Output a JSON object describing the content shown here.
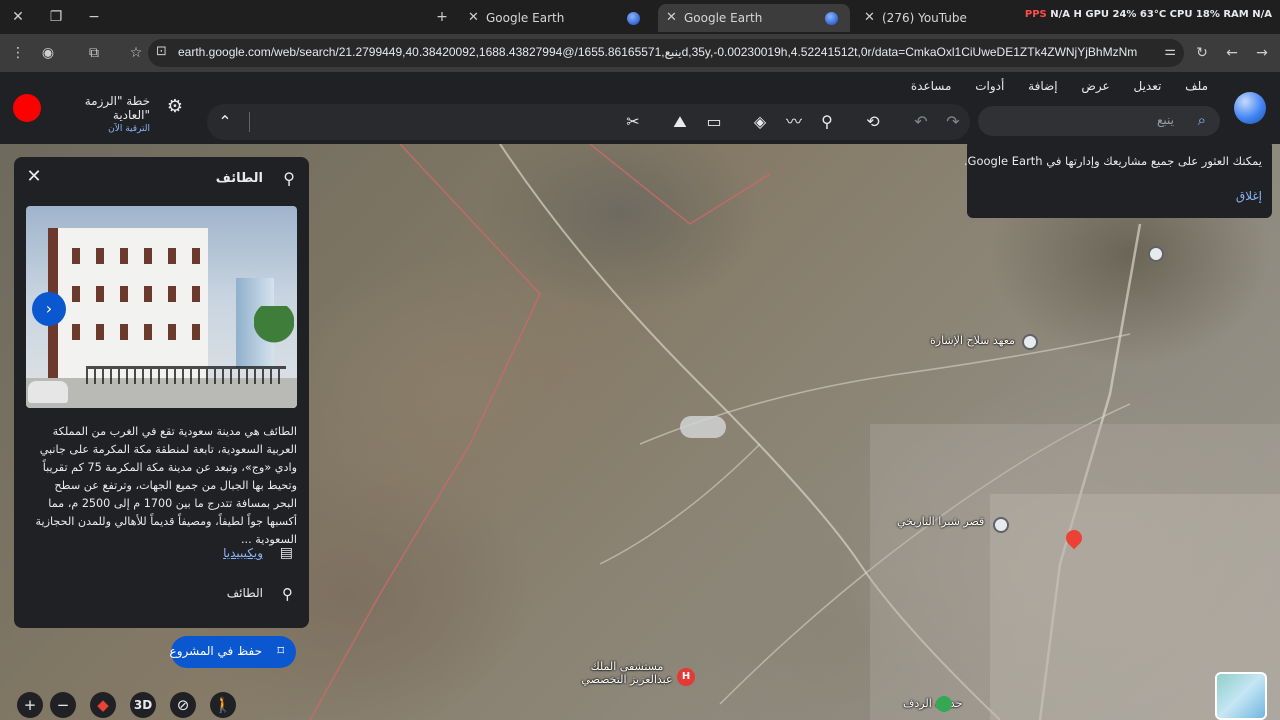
{
  "browser": {
    "tabs": [
      {
        "title": "Google Earth",
        "active": false
      },
      {
        "title": "Google Earth",
        "active": true
      },
      {
        "title": "(276) YouTube",
        "active": false
      }
    ],
    "new_tab_label": "+",
    "stats": {
      "pps": "PPS",
      "pps_val": "N/A",
      "gpu": "GPU 24% 63°C",
      "cpu": "CPU 18%",
      "ram": "RAM",
      "ram_val": "N/A",
      "h": "H"
    },
    "url": "earth.google.com/web/search/21.2799449,40.38420092,1688.43827994@/ينبع,1655.86165571d,35y,-0.00230019h,4.52241512t,0r/data=CmkaOxl1CiUweDE1ZTk4ZWNjYjBhMzNmMmY6M..."
  },
  "earth": {
    "menu": [
      "ملف",
      "تعديل",
      "عرض",
      "إضافة",
      "أدوات",
      "مساعدة"
    ],
    "plan_title": "خطة \"الرزمة العادية\"",
    "plan_upgrade": "الترقية الآن",
    "search_placeholder": "ينبع",
    "toolbar_icons": [
      "measure-icon",
      "image-icon",
      "ruler-icon",
      "layers-icon",
      "path-icon",
      "placemark-icon",
      "history-icon",
      "undo-icon",
      "redo-icon"
    ]
  },
  "panel": {
    "title": "الطائف",
    "description": "الطائف هي مدينة سعودية تقع في الغرب من المملكة العربية السعودية، تابعة لمنطقة مكة المكرمة على جانبي وادي «وج»، وتبعد عن مدينة مكة المكرمة 75 كم تقريباً وتحيط بها الجبال من جميع الجهات، وترتفع عن سطح البحر بمسافة تتدرج ما بين 1700 م إلى 2500 م، مما أكسبها جواً لطيفاً، ومصيفاً قديماً للأهالي وللمدن الحجازية السعودية ...",
    "wiki_label": "ويكيبيديا",
    "location_label": "الطائف",
    "save_label": "حفظ في المشروع"
  },
  "notice": {
    "text": "يمكنك العثور على جميع مشاريعك وإدارتها في Google Earth.",
    "close_label": "إغلاق"
  },
  "map": {
    "labels": [
      {
        "id": "label-1",
        "text": "معهد سلاح الإشارة"
      },
      {
        "id": "label-2",
        "text": "قصر شبرا التاريخي"
      },
      {
        "id": "label-3",
        "text": "مستشفى الملك عبدالعزيز التخصصي"
      },
      {
        "id": "label-4",
        "text": "حديقة الردف"
      }
    ]
  },
  "controls": {
    "zoom_in": "+",
    "zoom_out": "−",
    "three_d": "3D"
  },
  "colors": {
    "accent": "#0b57d0",
    "link": "#8ab4f8",
    "panel_bg": "#202124",
    "logo_red": "#ff0000"
  }
}
